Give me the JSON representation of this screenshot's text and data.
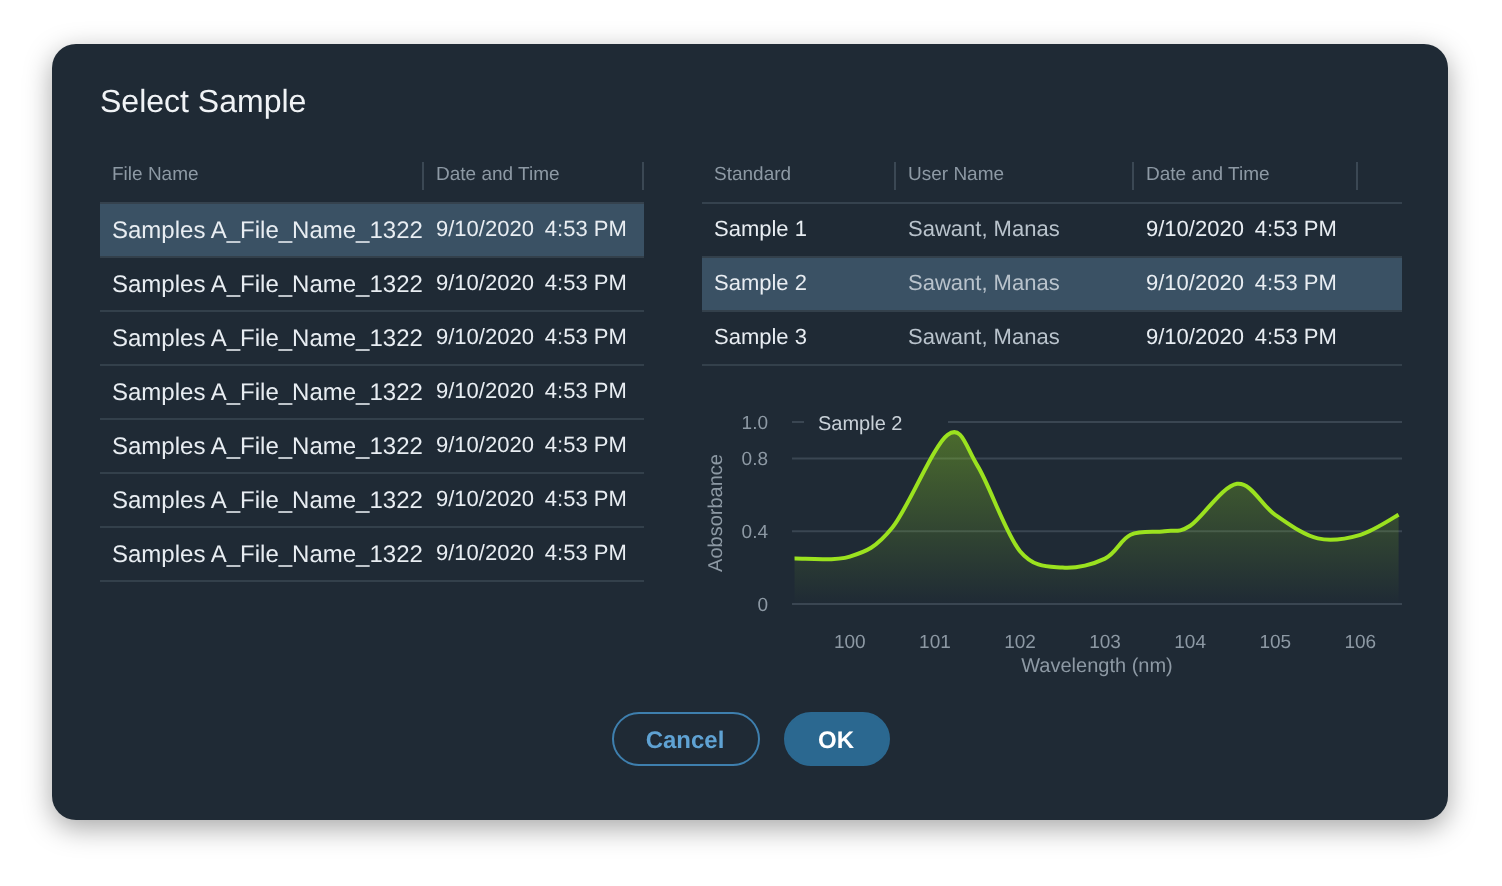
{
  "dialog": {
    "title": "Select Sample"
  },
  "files": {
    "columns": [
      "File Name",
      "Date and Time"
    ],
    "rows": [
      {
        "name": "Samples A_File_Name_1322",
        "date": "9/10/2020",
        "time": "4:53 PM",
        "selected": true
      },
      {
        "name": "Samples A_File_Name_1322",
        "date": "9/10/2020",
        "time": "4:53 PM",
        "selected": false
      },
      {
        "name": "Samples A_File_Name_1322",
        "date": "9/10/2020",
        "time": "4:53 PM",
        "selected": false
      },
      {
        "name": "Samples A_File_Name_1322",
        "date": "9/10/2020",
        "time": "4:53 PM",
        "selected": false
      },
      {
        "name": "Samples A_File_Name_1322",
        "date": "9/10/2020",
        "time": "4:53 PM",
        "selected": false
      },
      {
        "name": "Samples A_File_Name_1322",
        "date": "9/10/2020",
        "time": "4:53 PM",
        "selected": false
      },
      {
        "name": "Samples A_File_Name_1322",
        "date": "9/10/2020",
        "time": "4:53 PM",
        "selected": false
      }
    ]
  },
  "standards": {
    "columns": [
      "Standard",
      "User Name",
      "Date and Time"
    ],
    "rows": [
      {
        "standard": "Sample 1",
        "user": "Sawant, Manas",
        "date": "9/10/2020",
        "time": "4:53 PM",
        "selected": false
      },
      {
        "standard": "Sample 2",
        "user": "Sawant, Manas",
        "date": "9/10/2020",
        "time": "4:53 PM",
        "selected": true
      },
      {
        "standard": "Sample 3",
        "user": "Sawant, Manas",
        "date": "9/10/2020",
        "time": "4:53 PM",
        "selected": false
      }
    ]
  },
  "chart": {
    "chart_data": {
      "type": "area",
      "xlabel": "Wavelength (nm)",
      "ylabel": "Aobsorbance",
      "x": [
        99.35,
        100,
        100.5,
        101.15,
        101.5,
        102,
        102.5,
        103,
        103.3,
        103.7,
        104,
        104.55,
        105,
        105.5,
        106,
        106.45
      ],
      "series": [
        {
          "name": "Sample 2",
          "color": "#9be21f",
          "values": [
            0.25,
            0.26,
            0.42,
            0.93,
            0.76,
            0.29,
            0.2,
            0.25,
            0.38,
            0.4,
            0.43,
            0.66,
            0.49,
            0.36,
            0.38,
            0.49
          ]
        }
      ],
      "xlim": [
        99.32,
        106.49
      ],
      "ylim": [
        0,
        1.0
      ],
      "xticks": [
        100,
        101,
        102,
        103,
        104,
        105,
        106
      ],
      "yticks": [
        0,
        0.4,
        0.8,
        {
          "value": 1.0,
          "label": "1.0"
        }
      ],
      "grid": true
    }
  },
  "buttons": [
    {
      "label": "Cancel",
      "kind": "secondary"
    },
    {
      "label": "OK",
      "kind": "primary"
    }
  ]
}
